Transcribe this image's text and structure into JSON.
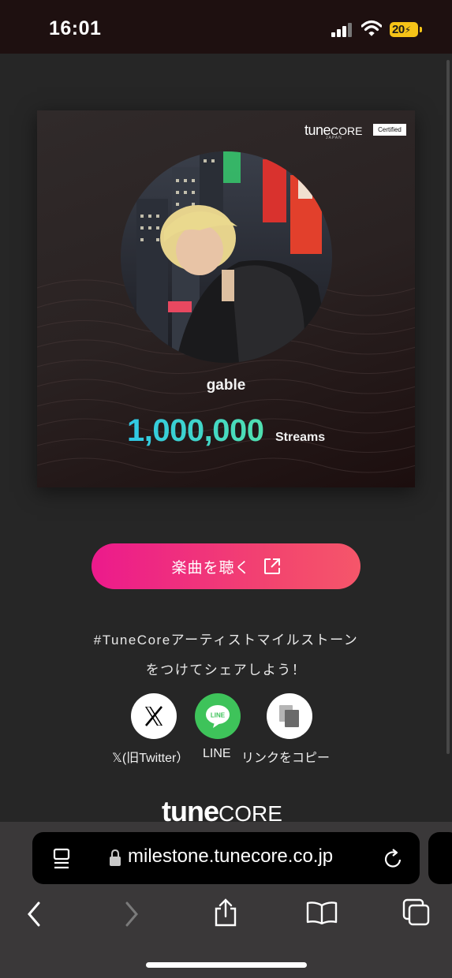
{
  "status_bar": {
    "time": "16:01",
    "battery_level": "20",
    "battery_color": "#f5c318"
  },
  "card": {
    "logo_tune": "tune",
    "logo_core": "CORE",
    "logo_sub": "JAPAN",
    "badge": "Certified",
    "artist_name": "gable",
    "stream_count": "1,000,000",
    "stream_unit": "Streams"
  },
  "actions": {
    "listen_label": "楽曲を聴く",
    "listen_icon": "external-link-icon",
    "share_line_1": "#TuneCoreアーティストマイルストーン",
    "share_line_2": "をつけてシェアしよう！",
    "share_buttons": [
      {
        "label": "𝕏(旧Twitter）",
        "icon": "x-logo-icon"
      },
      {
        "label": "LINE",
        "icon": "line-icon",
        "icon_text": "LINE"
      },
      {
        "label": "リンクをコピー",
        "icon": "copy-icon"
      }
    ]
  },
  "footer": {
    "logo_tune": "tune",
    "logo_core": "CORE"
  },
  "browser": {
    "url": "milestone.tunecore.co.jp",
    "toolbar": [
      "back-icon",
      "forward-icon",
      "share-icon",
      "bookmarks-icon",
      "tabs-icon"
    ]
  },
  "colors": {
    "accent_gradient_start": "#ec1a8c",
    "accent_gradient_end": "#f5566a",
    "stream_gradient_start": "#2fc8e6",
    "stream_gradient_end": "#50e0b0",
    "line_green": "#3ec35a"
  }
}
